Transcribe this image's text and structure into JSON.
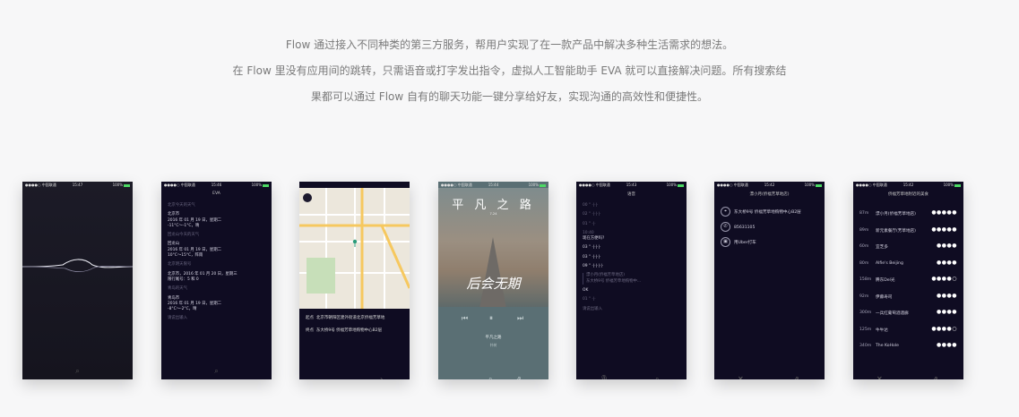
{
  "intro": {
    "line1": "Flow 通过接入不同种类的第三方服务，帮用户实现了在一款产品中解决多种生活需求的想法。",
    "line2": "在 Flow 里没有应用间的跳转，只需语音或打字发出指令，虚拟人工智能助手 EVA 就可以直接解决问题。所有搜索结",
    "line3": "果都可以通过 Flow 自有的聊天功能一键分享给好友，实现沟通的高效性和便捷性。"
  },
  "status": {
    "carrier": "●●●●○ 中国联通",
    "battery": "100%"
  },
  "p1": {
    "time": "15:47"
  },
  "p2": {
    "time": "15:46",
    "title": "EVA",
    "messages": [
      {
        "q": "北京今天的天气",
        "a1": "北京市",
        "a2": "2016 年 01 月 19 日，星期二",
        "a3": "-11°C～-1°C，晴"
      },
      {
        "q": "回龙山今天的天气",
        "a1": "回龙山",
        "a2": "2016 年 01 月 19 日，星期二",
        "a3": "10°C～15°C，阵雨"
      },
      {
        "q": "北京明天限号",
        "a1": "北京市，2016 年 01 月 20 日，星期三",
        "a2": "限行尾号：5 和 0",
        "a3": ""
      },
      {
        "q": "青岛的天气",
        "a1": "青岛市",
        "a2": "2016 年 01 月 19 日，星期二",
        "a3": "-8°C～-2°C，晴"
      }
    ],
    "input": "请说出输入"
  },
  "p3": {
    "from_label": "起点",
    "from": "北京市朝阳区建外街道北京侨福芳草地",
    "to_label": "终点",
    "to": "东大桥9号 侨福芳草地购物中心B2层"
  },
  "p4": {
    "time": "15:44",
    "poster_title": "平 凡 之 路",
    "poster_sub": "7.24",
    "poster_calli": "后会无期",
    "song": "平凡之路",
    "artist": "朴树"
  },
  "p5": {
    "time": "15:43",
    "title": "语音",
    "items": [
      {
        "d": "00 \" ·|·|·",
        "w": ""
      },
      {
        "d": "02 \" ·|·|·|·",
        "w": ""
      },
      {
        "d": "01 \" ·|·",
        "w": ""
      },
      {
        "d": "10:40",
        "w": "现在方便吗?"
      },
      {
        "d": "",
        "w": "03 \" ·|·|·|·"
      },
      {
        "d": "",
        "w": "03 \" ·|·|·|·"
      },
      {
        "d": "",
        "w": "09 \" ·|·|·|·|·"
      },
      {
        "d": "漂小月(侨福芳草地店)",
        "w": ""
      },
      {
        "d": "东大桥9号 侨福芳草地购物中...",
        "w": ""
      },
      {
        "d": "",
        "w": "OK"
      },
      {
        "d": "01 \" ·|·",
        "w": ""
      }
    ],
    "input": "请说出输入"
  },
  "p6": {
    "time": "15:42",
    "title": "漂小月(侨福芳草地店)",
    "addr": "东大桥9号 侨福芳草地购物中心B2层",
    "phone": "85631105",
    "uber": "用Uber打车"
  },
  "p7": {
    "time": "15:42",
    "title": "侨福芳草地附近的美食",
    "rows": [
      {
        "dist": "87m",
        "name": "漂小月(侨福芳草地店)",
        "stars": "●●●●●"
      },
      {
        "dist": "89m",
        "name": "新元素餐厅(芳草地店)",
        "stars": "●●●●●"
      },
      {
        "dist": "60m",
        "name": "宜芝多",
        "stars": "●●●●"
      },
      {
        "dist": "80m",
        "name": "Alfie's Beijing",
        "stars": "●●●●"
      },
      {
        "dist": "158m",
        "name": "腾东Del光",
        "stars": "●●●●○"
      },
      {
        "dist": "92m",
        "name": "伊藤寿司",
        "stars": "●●●●"
      },
      {
        "dist": "300m",
        "name": "一兵红葡萄酒酒廊",
        "stars": "●●●●"
      },
      {
        "dist": "125m",
        "name": "牛牛达",
        "stars": "●●●●○"
      },
      {
        "dist": "340m",
        "name": "The KoHole",
        "stars": "●●●●"
      }
    ]
  }
}
